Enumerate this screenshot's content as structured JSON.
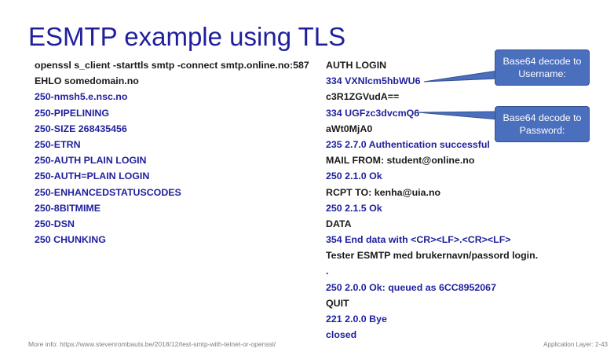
{
  "slide": {
    "title": "ESMTP example using TLS",
    "left_lines": [
      {
        "text": "openssl s_client -starttls smtp -connect smtp.online.no:587",
        "color": "black"
      },
      {
        "text": "EHLO somedomain.no",
        "color": "black"
      },
      {
        "text": "250-nmsh5.e.nsc.no",
        "color": "blue"
      },
      {
        "text": "250-PIPELINING",
        "color": "blue"
      },
      {
        "text": "250-SIZE 268435456",
        "color": "blue"
      },
      {
        "text": "250-ETRN",
        "color": "blue"
      },
      {
        "text": "250-AUTH PLAIN LOGIN",
        "color": "blue"
      },
      {
        "text": "250-AUTH=PLAIN LOGIN",
        "color": "blue"
      },
      {
        "text": "250-ENHANCEDSTATUSCODES",
        "color": "blue"
      },
      {
        "text": "250-8BITMIME",
        "color": "blue"
      },
      {
        "text": "250-DSN",
        "color": "blue"
      },
      {
        "text": "250 CHUNKING",
        "color": "blue"
      }
    ],
    "right_lines": [
      {
        "text": "AUTH LOGIN",
        "color": "black"
      },
      {
        "text": "334 VXNlcm5hbWU6",
        "color": "blue"
      },
      {
        "text": "c3R1ZGVudA==",
        "color": "black"
      },
      {
        "text": "334 UGFzc3dvcmQ6",
        "color": "blue"
      },
      {
        "text": "aWt0MjA0",
        "color": "black"
      },
      {
        "text": "235 2.7.0 Authentication successful",
        "color": "blue"
      },
      {
        "text": "MAIL FROM: student@online.no",
        "color": "black"
      },
      {
        "text": "250 2.1.0 Ok",
        "color": "blue"
      },
      {
        "text": "RCPT TO: kenha@uia.no",
        "color": "black"
      },
      {
        "text": "250 2.1.5 Ok",
        "color": "blue"
      },
      {
        "text": "DATA",
        "color": "black"
      },
      {
        "text": "354 End data with <CR><LF>.<CR><LF>",
        "color": "blue"
      },
      {
        "text": "Tester ESMTP med brukernavn/passord login.",
        "color": "black"
      },
      {
        "text": ".",
        "color": "black"
      },
      {
        "text": "250 2.0.0 Ok: queued as 6CC8952067",
        "color": "blue"
      },
      {
        "text": "QUIT",
        "color": "black"
      },
      {
        "text": "221 2.0.0 Bye",
        "color": "blue"
      },
      {
        "text": "closed",
        "color": "blue"
      }
    ],
    "callouts": {
      "username": {
        "line1": "Base64 decode to",
        "line2": "Username:"
      },
      "password": {
        "line1": "Base64 decode to",
        "line2": "Password:"
      }
    },
    "footer": {
      "more_info": "More info: https://www.stevenrombauts.be/2018/12/test-smtp-with-telnet-or-openssl/",
      "page_label": "Application Layer: 2-43"
    },
    "colors": {
      "title": "#1f1f9e",
      "blue_text": "#1f1f9e",
      "black_text": "#1a1a1a",
      "callout_fill": "#4a6fbd"
    }
  }
}
